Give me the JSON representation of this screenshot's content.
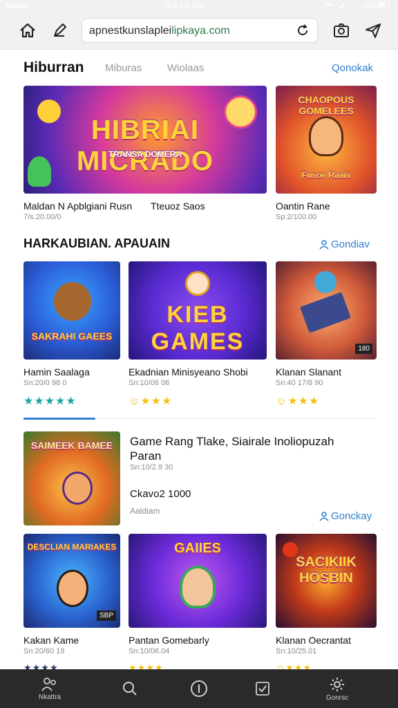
{
  "status": {
    "carrier": "Mabit",
    "time": "3:4 1S 2M",
    "battery": "9%"
  },
  "browser": {
    "url_prefix": "apnestkunslaplei",
    "url_domain": "lipkaya.com"
  },
  "section1": {
    "title": "Hiburran",
    "tabs": [
      "Miburas",
      "Wiolaas"
    ],
    "link": "Qonokak",
    "cards": [
      {
        "art": "HIBRIAI MICRADO",
        "art_small": "TRANSA DOMERA",
        "label": "Maldan N Apblgiani Rusn",
        "label2": "Tteuoz Saos",
        "sub": "7/s.20.00/0"
      },
      {
        "art": "CHAOPOUS GOMELEES",
        "art_small": "Fusoe Raais",
        "label": "Oantin Rane",
        "sub": "Sp:2/100.00"
      }
    ]
  },
  "section2": {
    "title": "HARKAUBIAN. APAUAIN",
    "link": "Gondiav",
    "cards": [
      {
        "art": "SAKRAHI GAEES",
        "label": "Hamin Saalaga",
        "sub": "Sn:20/0 98 0",
        "stars": "★★★★★"
      },
      {
        "art": "KIEB GAMES",
        "label": "Ekadnian Minisyeano Shobi",
        "sub": "Sn:10/06 06",
        "stars": "☺★★★"
      },
      {
        "art": "",
        "badge": "180",
        "label": "Klanan Slanant",
        "sub": "Sn:40 17/8 90",
        "stars": "☺★★★"
      }
    ]
  },
  "featured": {
    "art": "SAIMEEK BAMEE",
    "title": "Game Rang Tlake, Siairale Inoliopuzah Paran",
    "sub": "Sn:10/2.9 30",
    "price": "Ckavo2 1000",
    "meta": "Aaldiam",
    "link": "Gonckay"
  },
  "section3": {
    "cards": [
      {
        "art": "DESCLIAN MARIAKES",
        "badge": "SBP",
        "label": "Kakan Kame",
        "sub": "Sn:20/60 19",
        "stars": "★★★★"
      },
      {
        "art": "GAIIES",
        "label": "Pantan Gomebarly",
        "sub": "Sn:10/06.04",
        "stars": "★★★★"
      },
      {
        "art": "SACIKIIK HOSBIN",
        "label": "Klanan Oecrantat",
        "sub": "Sn:10/25.01",
        "stars": "☺★★★"
      }
    ]
  },
  "nav": {
    "items": [
      {
        "label": "Nkattra"
      },
      {
        "label": ""
      },
      {
        "label": ""
      },
      {
        "label": ""
      },
      {
        "label": "Gonrsc"
      }
    ]
  },
  "colors": {
    "accent": "#2f7fd0",
    "nav_bg": "#2a2a2a",
    "star_teal": "#1aa3a3",
    "star_gold": "#f2c21a",
    "star_navy": "#2b3a67"
  }
}
